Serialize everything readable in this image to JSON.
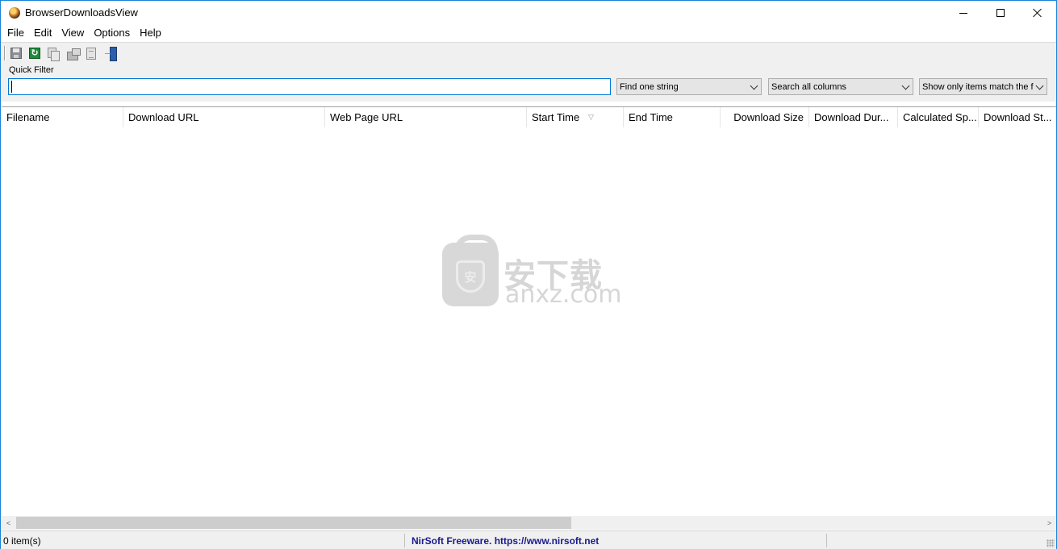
{
  "window": {
    "title": "BrowserDownloadsView",
    "controls": [
      "minimize",
      "maximize",
      "close"
    ]
  },
  "menu": [
    "File",
    "Edit",
    "View",
    "Options",
    "Help"
  ],
  "toolbar": {
    "icons": [
      "save-icon",
      "refresh-icon",
      "copy-icon",
      "properties-icon",
      "html-report-icon",
      "exit-icon"
    ]
  },
  "quick_filter": {
    "label": "Quick Filter",
    "value": "",
    "mode": "Find one string",
    "columns": "Search all columns",
    "show": "Show only items match the f"
  },
  "table": {
    "columns": [
      "Filename",
      "Download URL",
      "Web Page URL",
      "Start Time",
      "End Time",
      "Download Size",
      "Download Dur...",
      "Calculated Sp...",
      "Download St..."
    ],
    "sorted_column": "Start Time",
    "rows": []
  },
  "watermark": {
    "text_cn": "安下载",
    "text_en": "anxz.com",
    "shield_char": "安"
  },
  "scrollbar": {
    "left_arrow": "<",
    "right_arrow": ">"
  },
  "status": {
    "count": "0 item(s)",
    "link": "NirSoft Freeware. https://www.nirsoft.net"
  }
}
